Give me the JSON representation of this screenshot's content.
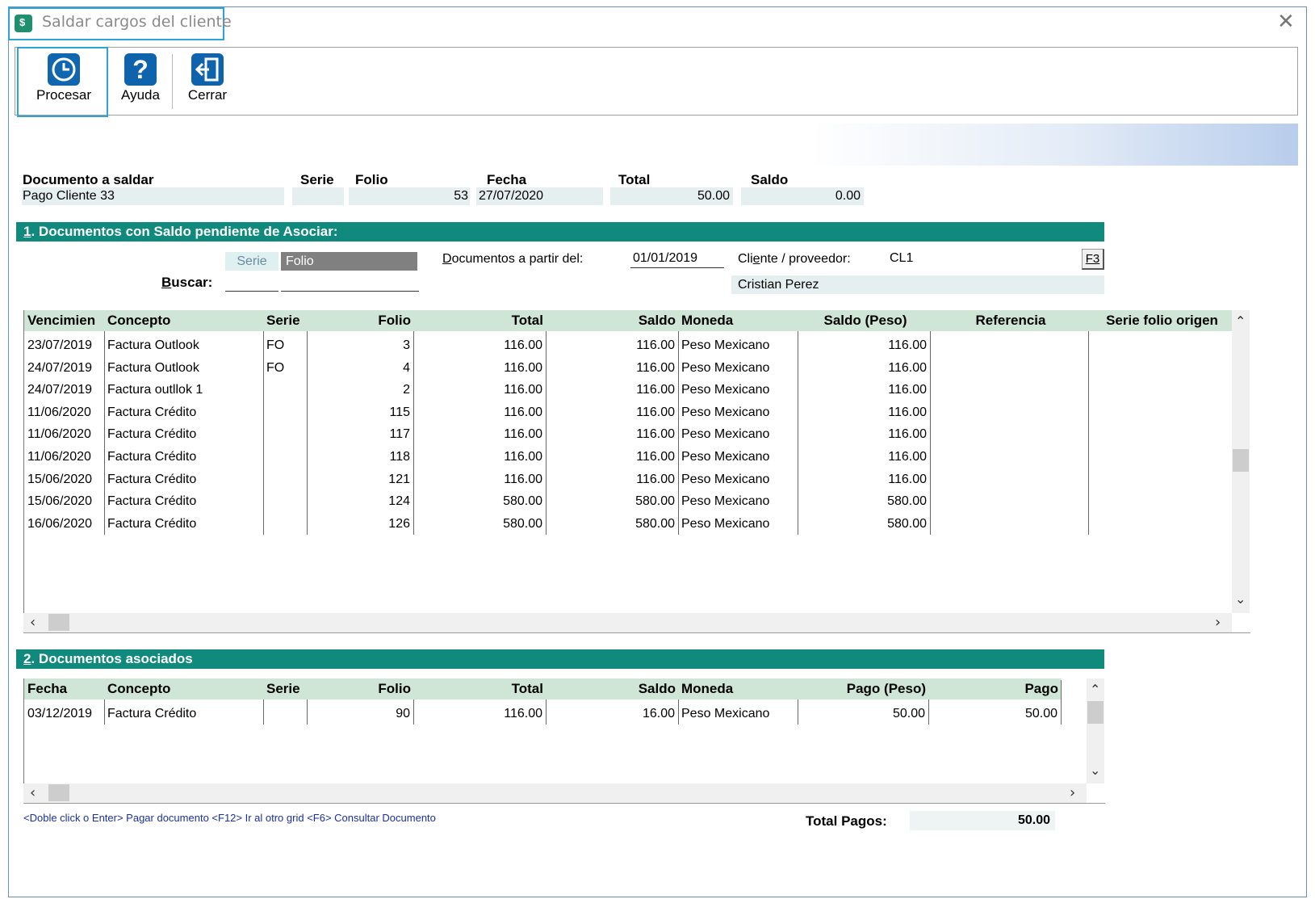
{
  "window": {
    "title": "Saldar cargos del cliente"
  },
  "toolbar": {
    "procesar_label": "Procesar",
    "ayuda_label": "Ayuda",
    "cerrar_label": "Cerrar"
  },
  "header": {
    "labels": {
      "documento": "Documento a saldar",
      "serie": "Serie",
      "folio": "Folio",
      "fecha": "Fecha",
      "total": "Total",
      "saldo": "Saldo"
    },
    "values": {
      "documento": "Pago Cliente 33",
      "serie": "",
      "folio": "53",
      "fecha": "27/07/2020",
      "total": "50.00",
      "saldo": "0.00"
    }
  },
  "section1": {
    "number": "1",
    "title": ". Documentos con Saldo pendiente de Asociar:",
    "search_tab_serie": "Serie",
    "search_tab_folio": "Folio",
    "buscar_label": "Buscar:",
    "docs_from_label": "Documentos a partir del:",
    "docs_from_value": "01/01/2019",
    "cliente_label": "Cliente / proveedor:",
    "cliente_value": "CL1",
    "f3_button": "F3",
    "cliente_name": "Cristian Perez",
    "columns": [
      "Vencimien",
      "Concepto",
      "Serie",
      "Folio",
      "Total",
      "Saldo",
      "Moneda",
      "Saldo (Peso)",
      "Referencia",
      "Serie folio origen"
    ],
    "rows": [
      [
        "23/07/2019",
        "Factura Outlook",
        "FO",
        "3",
        "116.00",
        "116.00",
        "Peso Mexicano",
        "116.00",
        "",
        ""
      ],
      [
        "24/07/2019",
        "Factura Outlook",
        "FO",
        "4",
        "116.00",
        "116.00",
        "Peso Mexicano",
        "116.00",
        "",
        ""
      ],
      [
        "24/07/2019",
        "Factura outllok 1",
        "",
        "2",
        "116.00",
        "116.00",
        "Peso Mexicano",
        "116.00",
        "",
        ""
      ],
      [
        "11/06/2020",
        "Factura Crédito",
        "",
        "115",
        "116.00",
        "116.00",
        "Peso Mexicano",
        "116.00",
        "",
        ""
      ],
      [
        "11/06/2020",
        "Factura Crédito",
        "",
        "117",
        "116.00",
        "116.00",
        "Peso Mexicano",
        "116.00",
        "",
        ""
      ],
      [
        "11/06/2020",
        "Factura Crédito",
        "",
        "118",
        "116.00",
        "116.00",
        "Peso Mexicano",
        "116.00",
        "",
        ""
      ],
      [
        "15/06/2020",
        "Factura Crédito",
        "",
        "121",
        "116.00",
        "116.00",
        "Peso Mexicano",
        "116.00",
        "",
        ""
      ],
      [
        "15/06/2020",
        "Factura Crédito",
        "",
        "124",
        "580.00",
        "580.00",
        "Peso Mexicano",
        "580.00",
        "",
        ""
      ],
      [
        "16/06/2020",
        "Factura Crédito",
        "",
        "126",
        "580.00",
        "580.00",
        "Peso Mexicano",
        "580.00",
        "",
        ""
      ]
    ]
  },
  "section2": {
    "number": "2",
    "title": ". Documentos asociados",
    "columns": [
      "Fecha",
      "Concepto",
      "Serie",
      "Folio",
      "Total",
      "Saldo",
      "Moneda",
      "Pago (Peso)",
      "Pago"
    ],
    "rows": [
      [
        "03/12/2019",
        "Factura Crédito",
        "",
        "90",
        "116.00",
        "16.00",
        "Peso Mexicano",
        "50.00",
        "50.00"
      ]
    ]
  },
  "footer": {
    "help_text": "<Doble click o Enter> Pagar documento  <F12> Ir al otro grid  <F6> Consultar Documento",
    "total_label": "Total Pagos:",
    "total_value": "50.00"
  }
}
